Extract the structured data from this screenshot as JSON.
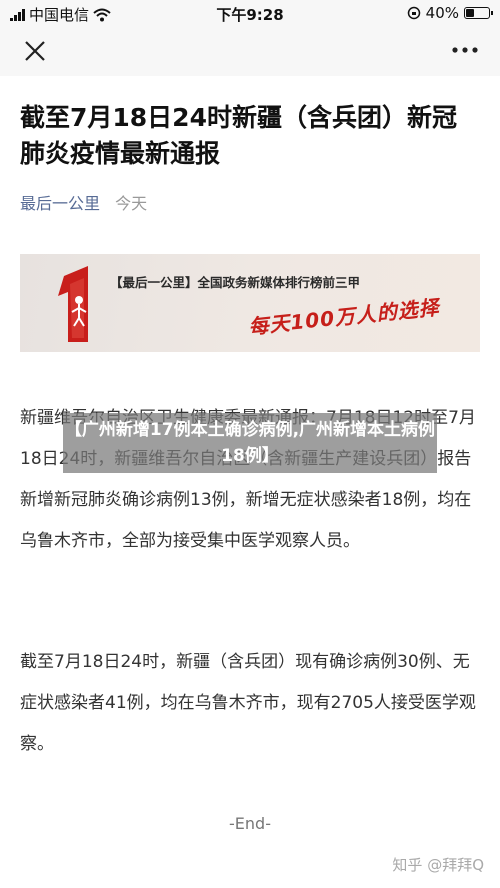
{
  "status_bar": {
    "carrier": "中国电信",
    "time": "下午9:28",
    "battery": "40%",
    "battery_level": 0.4
  },
  "nav": {
    "close_icon": "close-icon",
    "more_icon": "more-icon"
  },
  "article": {
    "title": "截至7月18日24时新疆（含兵团）新冠肺炎疫情最新通报",
    "account": "最后一公里",
    "date": "今天",
    "banner": {
      "caption": "【最后一公里】全国政务新媒体排行榜前三甲",
      "slogan": "每天100万人的选择"
    },
    "paragraphs": [
      "新疆维吾尔自治区卫生健康委最新通报：7月18日12时至7月18日24时，新疆维吾尔自治区（含新疆生产建设兵团）报告新增新冠肺炎确诊病例13例，新增无症状感染者18例，均在乌鲁木齐市，全部为接受集中医学观察人员。",
      "截至7月18日24时，新疆（含兵团）现有确诊病例30例、无症状感染者41例，均在乌鲁木齐市，现有2705人接受医学观察。"
    ],
    "end_mark": "-End-"
  },
  "overlay_title": "【广州新增17例本土确诊病例,广州新增本土病例18例】",
  "watermark": "知乎 @拜拜Q"
}
